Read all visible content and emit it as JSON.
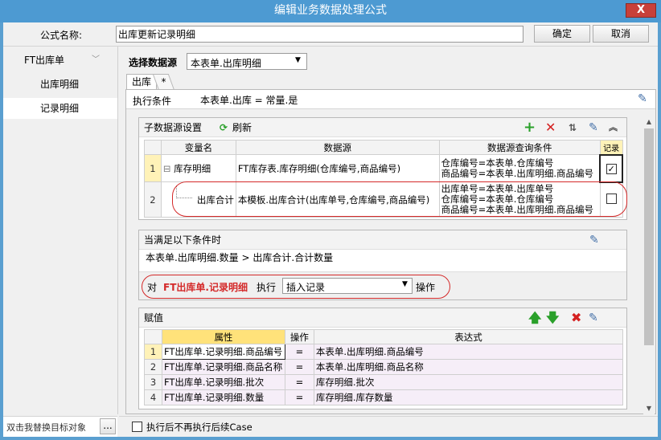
{
  "window": {
    "title": "编辑业务数据处理公式",
    "close_label": "X"
  },
  "header": {
    "name_label": "公式名称:",
    "name_value": "出库更新记录明细",
    "ok_label": "确定",
    "cancel_label": "取消"
  },
  "sidebar": {
    "group_label": "FT出库单",
    "items": [
      {
        "label": "出库明细"
      },
      {
        "label": "记录明细"
      }
    ],
    "bottom_text": "双击我替换目标对象",
    "bottom_button": "..."
  },
  "datasource": {
    "label": "选择数据源",
    "selected": "本表单.出库明细"
  },
  "tabs": [
    {
      "label": "出库"
    },
    {
      "label": "*"
    }
  ],
  "exec_condition": {
    "label": "执行条件",
    "value": "本表单.出库 = 常量.是"
  },
  "sub_ds": {
    "title": "子数据源设置",
    "refresh_label": "刷新",
    "columns": [
      "变量名",
      "数据源",
      "数据源查询条件",
      "记录"
    ],
    "rows": [
      {
        "num": "1",
        "tree": "⊟",
        "var": "库存明细",
        "source": "FT库存表.库存明细(仓库编号,商品编号)",
        "cond": [
          "仓库编号=本表单.仓库编号",
          "商品编号=本表单.出库明细.商品编号"
        ],
        "checked": true
      },
      {
        "num": "2",
        "tree": "",
        "var": "出库合计",
        "source": "本模板.出库合计(出库单号,仓库编号,商品编号)",
        "cond": [
          "出库单号=本表单.出库单号",
          "仓库编号=本表单.仓库编号",
          "商品编号=本表单.出库明细.商品编号"
        ],
        "checked": false
      }
    ]
  },
  "condition": {
    "title": "当满足以下条件时",
    "expr": "本表单.出库明细.数量 > 出库合计.合计数量",
    "for_label": "对",
    "target": "FT出库单.记录明细",
    "exec_label": "执行",
    "action": "插入记录",
    "op_label": "操作"
  },
  "assign": {
    "title": "赋值",
    "columns": [
      "属性",
      "操作",
      "表达式"
    ],
    "rows": [
      {
        "num": "1",
        "prop": "FT出库单.记录明细.商品编号",
        "op": "=",
        "expr": "本表单.出库明细.商品编号"
      },
      {
        "num": "2",
        "prop": "FT出库单.记录明细.商品名称",
        "op": "=",
        "expr": "本表单.出库明细.商品名称"
      },
      {
        "num": "3",
        "prop": "FT出库单.记录明细.批次",
        "op": "=",
        "expr": "库存明细.批次"
      },
      {
        "num": "4",
        "prop": "FT出库单.记录明细.数量",
        "op": "=",
        "expr": "库存明细.库存数量"
      }
    ]
  },
  "footer": {
    "stop_label": "执行后不再执行后续Case"
  },
  "colors": {
    "titlebar": "#4d9ad2",
    "close": "#c8403a",
    "add": "#2aa02a",
    "delete": "#d42020",
    "highlight_red": "#d42a2a",
    "row_pink": "#f6eef8",
    "current_row": "#fff2b8"
  }
}
